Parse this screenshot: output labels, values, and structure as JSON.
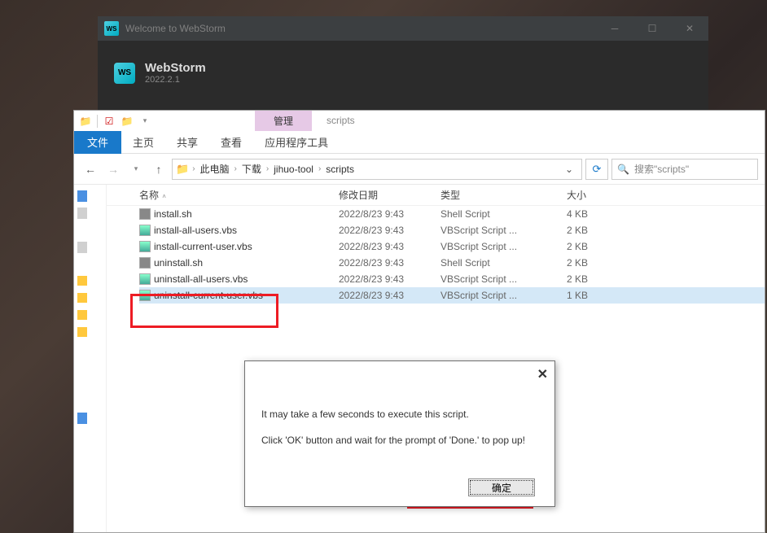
{
  "webstorm": {
    "titlebar_icon_text": "WS",
    "title": "Welcome to WebStorm",
    "big_icon_text": "WS",
    "name": "WebStorm",
    "version": "2022.2.1"
  },
  "explorer": {
    "ribbon_context_label": "管理",
    "ribbon_context_label2": "scripts",
    "tabs": {
      "file": "文件",
      "home": "主页",
      "share": "共享",
      "view": "查看",
      "apptools": "应用程序工具"
    },
    "breadcrumbs": [
      "此电脑",
      "下载",
      "jihuo-tool",
      "scripts"
    ],
    "search_placeholder": "搜索\"scripts\"",
    "columns": {
      "name": "名称",
      "date": "修改日期",
      "type": "类型",
      "size": "大小"
    },
    "files": [
      {
        "name": "install.sh",
        "date": "2022/8/23 9:43",
        "type": "Shell Script",
        "size": "4 KB",
        "icon": "sh",
        "selected": false
      },
      {
        "name": "install-all-users.vbs",
        "date": "2022/8/23 9:43",
        "type": "VBScript Script ...",
        "size": "2 KB",
        "icon": "vbs",
        "selected": false
      },
      {
        "name": "install-current-user.vbs",
        "date": "2022/8/23 9:43",
        "type": "VBScript Script ...",
        "size": "2 KB",
        "icon": "vbs",
        "selected": false
      },
      {
        "name": "uninstall.sh",
        "date": "2022/8/23 9:43",
        "type": "Shell Script",
        "size": "2 KB",
        "icon": "sh",
        "selected": false
      },
      {
        "name": "uninstall-all-users.vbs",
        "date": "2022/8/23 9:43",
        "type": "VBScript Script ...",
        "size": "2 KB",
        "icon": "vbs",
        "selected": false
      },
      {
        "name": "uninstall-current-user.vbs",
        "date": "2022/8/23 9:43",
        "type": "VBScript Script ...",
        "size": "1 KB",
        "icon": "vbs",
        "selected": true
      }
    ]
  },
  "dialog": {
    "line1": "It may take a few seconds to execute this script.",
    "line2": "Click 'OK' button and wait for the prompt of 'Done.' to pop up!",
    "ok": "确定"
  }
}
